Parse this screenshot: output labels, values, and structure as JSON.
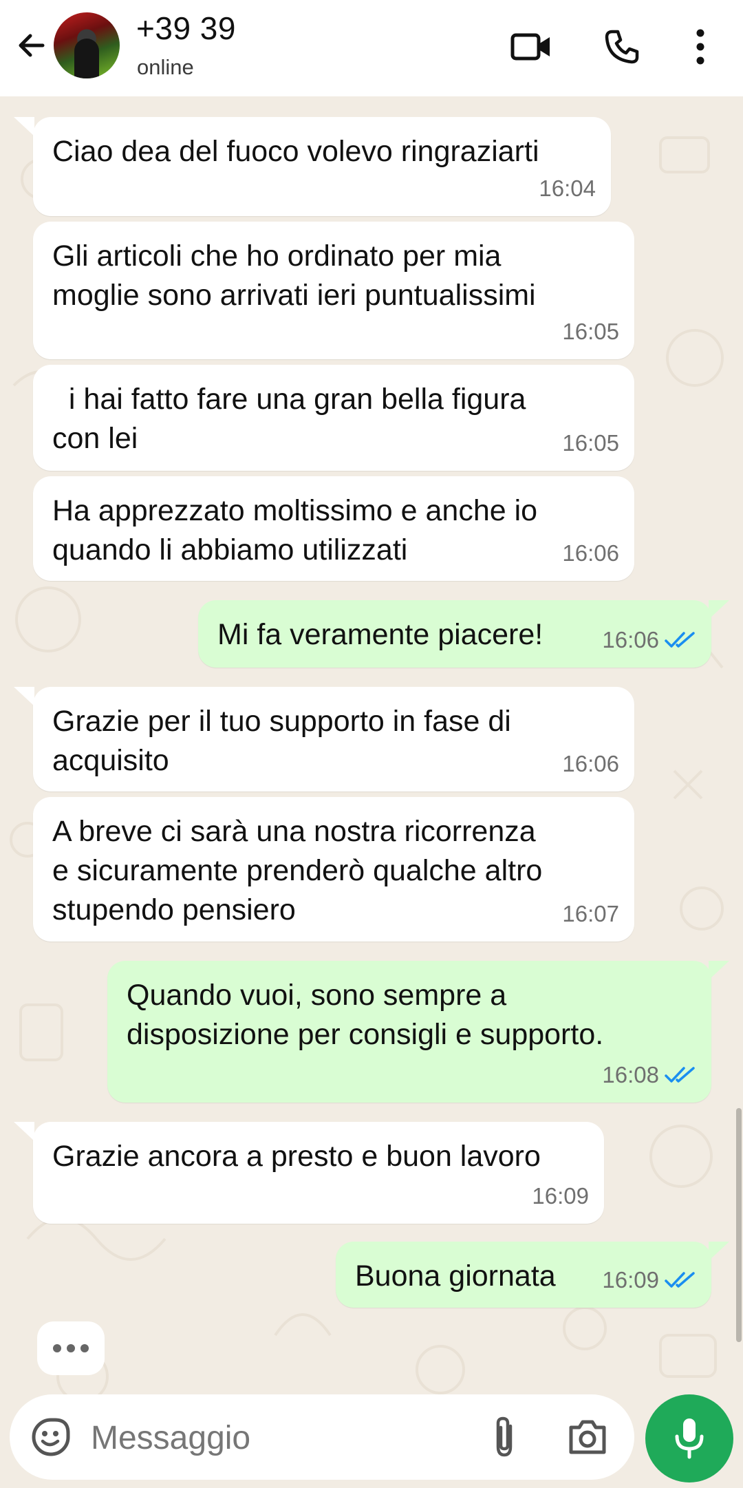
{
  "header": {
    "contact_name": "+39 39",
    "status": "online"
  },
  "messages": [
    {
      "dir": "in",
      "text": "Ciao dea del fuoco volevo ringraziarti",
      "time": "16:04"
    },
    {
      "dir": "in",
      "text": "Gli articoli che ho ordinato per mia\nmoglie sono arrivati ieri puntualissimi",
      "time": "16:05"
    },
    {
      "dir": "in",
      "text": "  i hai fatto fare una gran bella figura\ncon lei",
      "time": "16:05"
    },
    {
      "dir": "in",
      "text": "Ha apprezzato moltissimo e anche io\nquando li abbiamo utilizzati",
      "time": "16:06"
    },
    {
      "dir": "out",
      "text": "Mi fa veramente piacere!",
      "time": "16:06",
      "read": true
    },
    {
      "dir": "in",
      "text": "Grazie per il tuo supporto in fase di\nacquisito",
      "time": "16:06"
    },
    {
      "dir": "in",
      "text": "A breve ci sarà una nostra ricorrenza\ne sicuramente prenderò qualche altro\nstupendo pensiero",
      "time": "16:07"
    },
    {
      "dir": "out",
      "text": "Quando vuoi, sono sempre a\ndisposizione per consigli e supporto.",
      "time": "16:08",
      "read": true
    },
    {
      "dir": "in",
      "text": "Grazie ancora a presto e buon lavoro",
      "time": "16:09"
    },
    {
      "dir": "out",
      "text": "Buona giornata",
      "time": "16:09",
      "read": true
    }
  ],
  "composer": {
    "placeholder": "Messaggio"
  },
  "colors": {
    "outgoing_bubble": "#d9fdd3",
    "incoming_bubble": "#ffffff",
    "read_ticks": "#1a8ef0",
    "mic_button": "#1faa59"
  }
}
